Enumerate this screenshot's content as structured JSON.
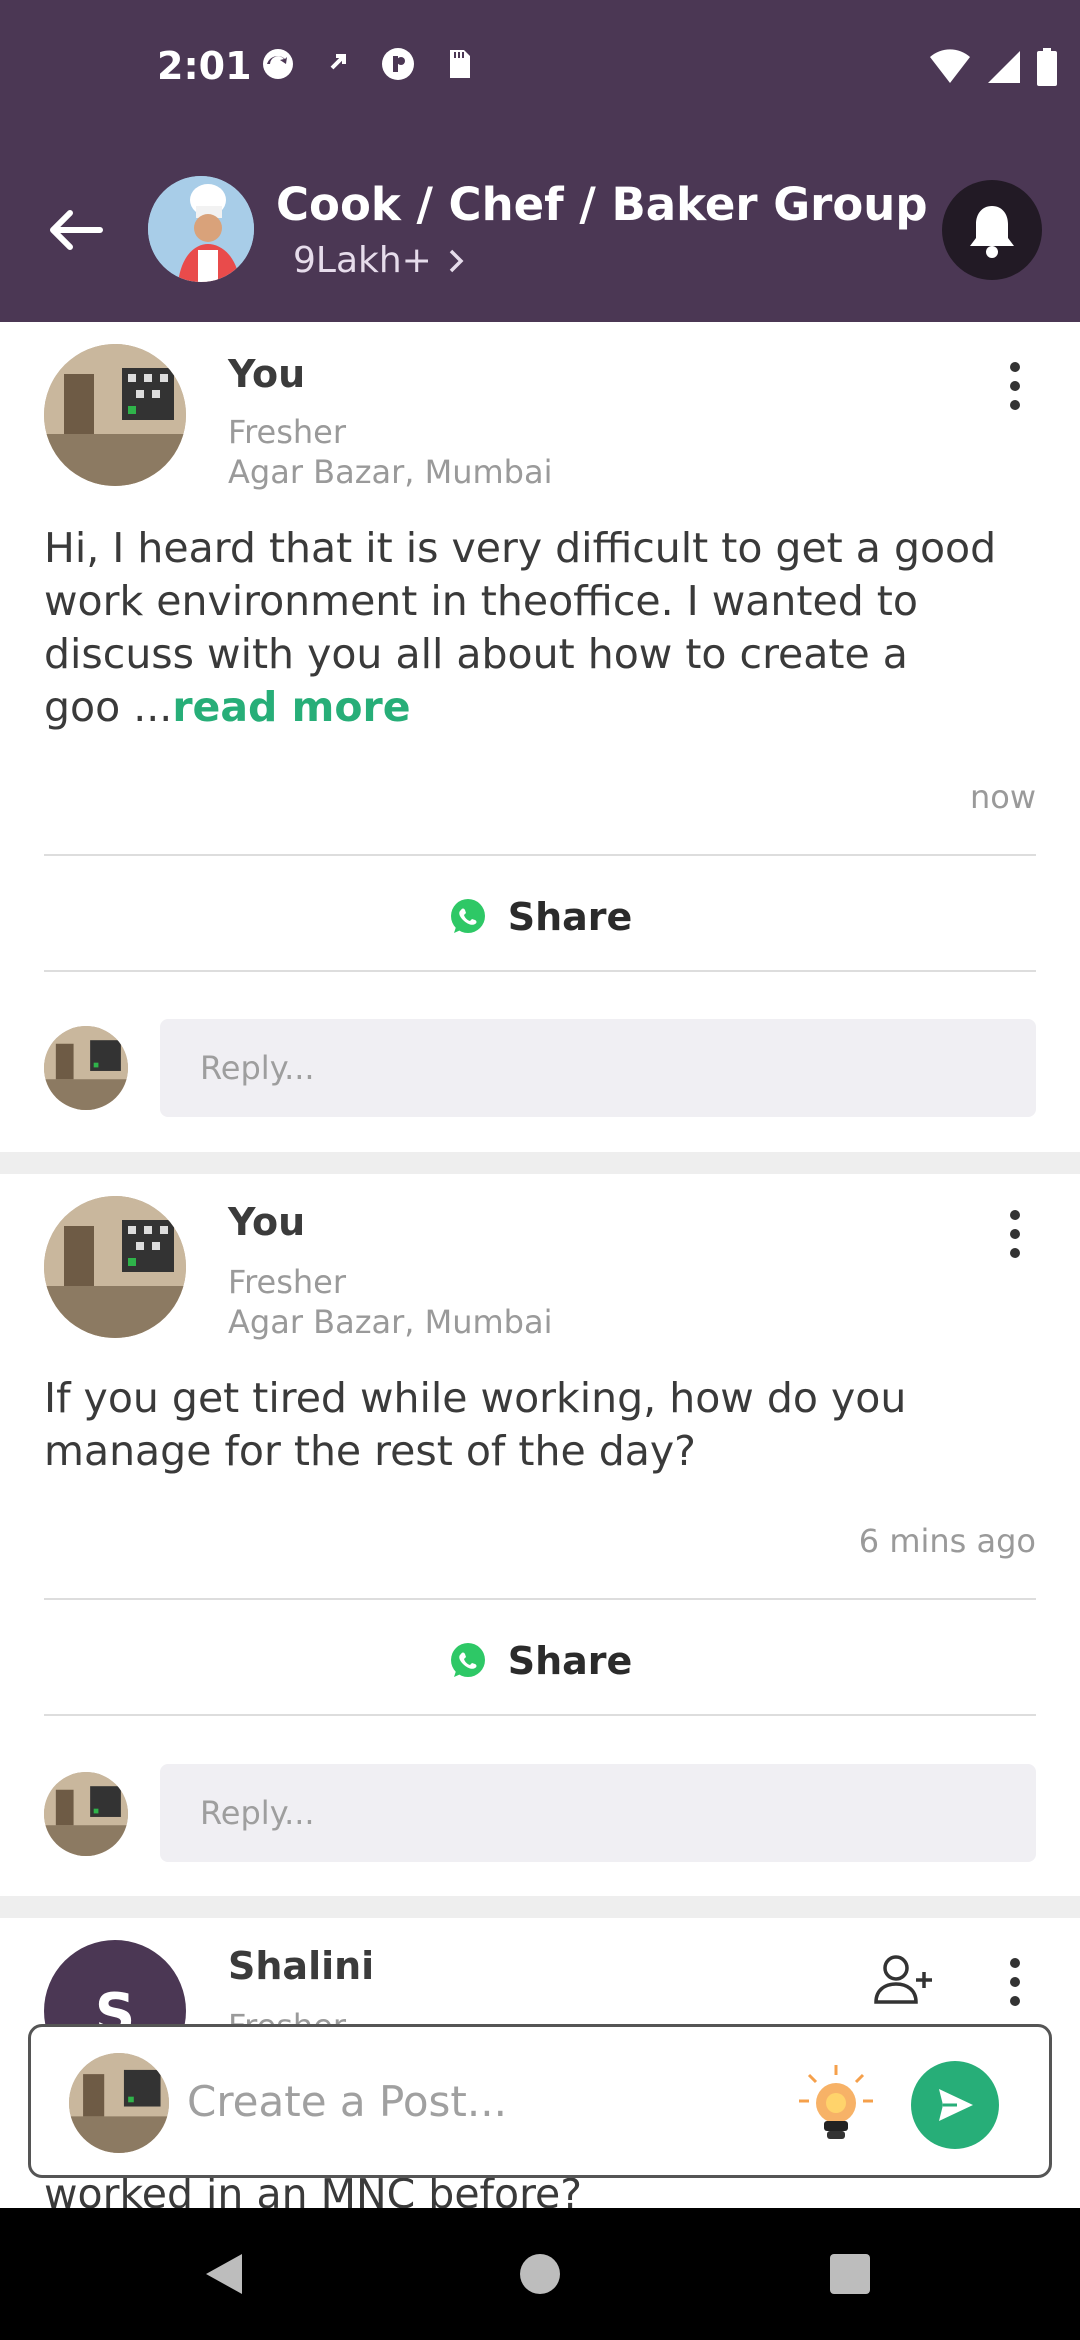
{
  "status_bar": {
    "time": "2:01",
    "left_icons": [
      "sync-icon",
      "download-icon",
      "app-icon",
      "sd-card-icon"
    ],
    "right_icons": [
      "wifi-icon",
      "signal-icon",
      "battery-icon"
    ]
  },
  "header": {
    "title": "Cook / Chef / Baker Group",
    "member_count": "9Lakh+",
    "colors": {
      "background": "#4b3754",
      "bell_bg": "#221a25"
    }
  },
  "posts": [
    {
      "author": "You",
      "role": "Fresher",
      "location": "Agar Bazar, Mumbai",
      "body_lines": [
        "Hi, I heard that it is very difficult to get a good",
        "work environment in theoffice. I wanted to",
        "discuss with you all about how to create a"
      ],
      "body_last": "goo ...",
      "read_more": "read more",
      "timestamp": "now",
      "share_label": "Share",
      "reply_placeholder": "Reply..."
    },
    {
      "author": "You",
      "role": "Fresher",
      "location": "Agar Bazar, Mumbai",
      "body_lines": [
        "If you get tired while working, how do you",
        "manage for the rest of the day?"
      ],
      "timestamp": "6 mins ago",
      "share_label": "Share",
      "reply_placeholder": "Reply..."
    },
    {
      "author": "Shalini",
      "avatar_letter": "S",
      "role_partial": "Fresher",
      "body_peek": "worked in an MNC before?"
    }
  ],
  "create_post": {
    "placeholder": "Create a Post..."
  },
  "accent_color": "#27ae78"
}
